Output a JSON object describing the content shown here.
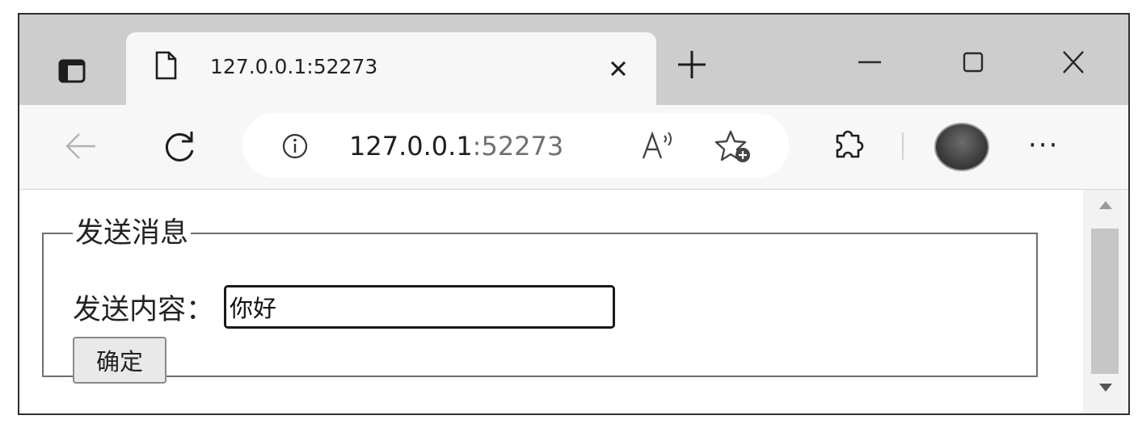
{
  "tab": {
    "title": "127.0.0.1:52273",
    "page_icon": "page-icon",
    "close_icon": "close-icon"
  },
  "titlebar": {
    "tab_actions_icon": "tab-actions-icon",
    "new_tab_icon": "plus-icon",
    "window_controls": [
      "minimize-icon",
      "maximize-icon",
      "close-icon"
    ]
  },
  "toolbar": {
    "back_icon": "arrow-left-icon",
    "reload_icon": "reload-icon",
    "url_host": "127.0.0.1",
    "url_port": ":52273",
    "info_icon": "info-icon",
    "read_aloud_icon": "read-aloud-icon",
    "favorites_icon": "star-add-icon",
    "extensions_icon": "puzzle-icon",
    "more_label": "···"
  },
  "form": {
    "legend": "发送消息",
    "label": "发送内容：",
    "input_value": "你好",
    "submit_label": "确定"
  },
  "colors": {
    "titlebar": "#cdcdcd",
    "toolbar": "#f7f7f7",
    "page": "#ffffff"
  }
}
